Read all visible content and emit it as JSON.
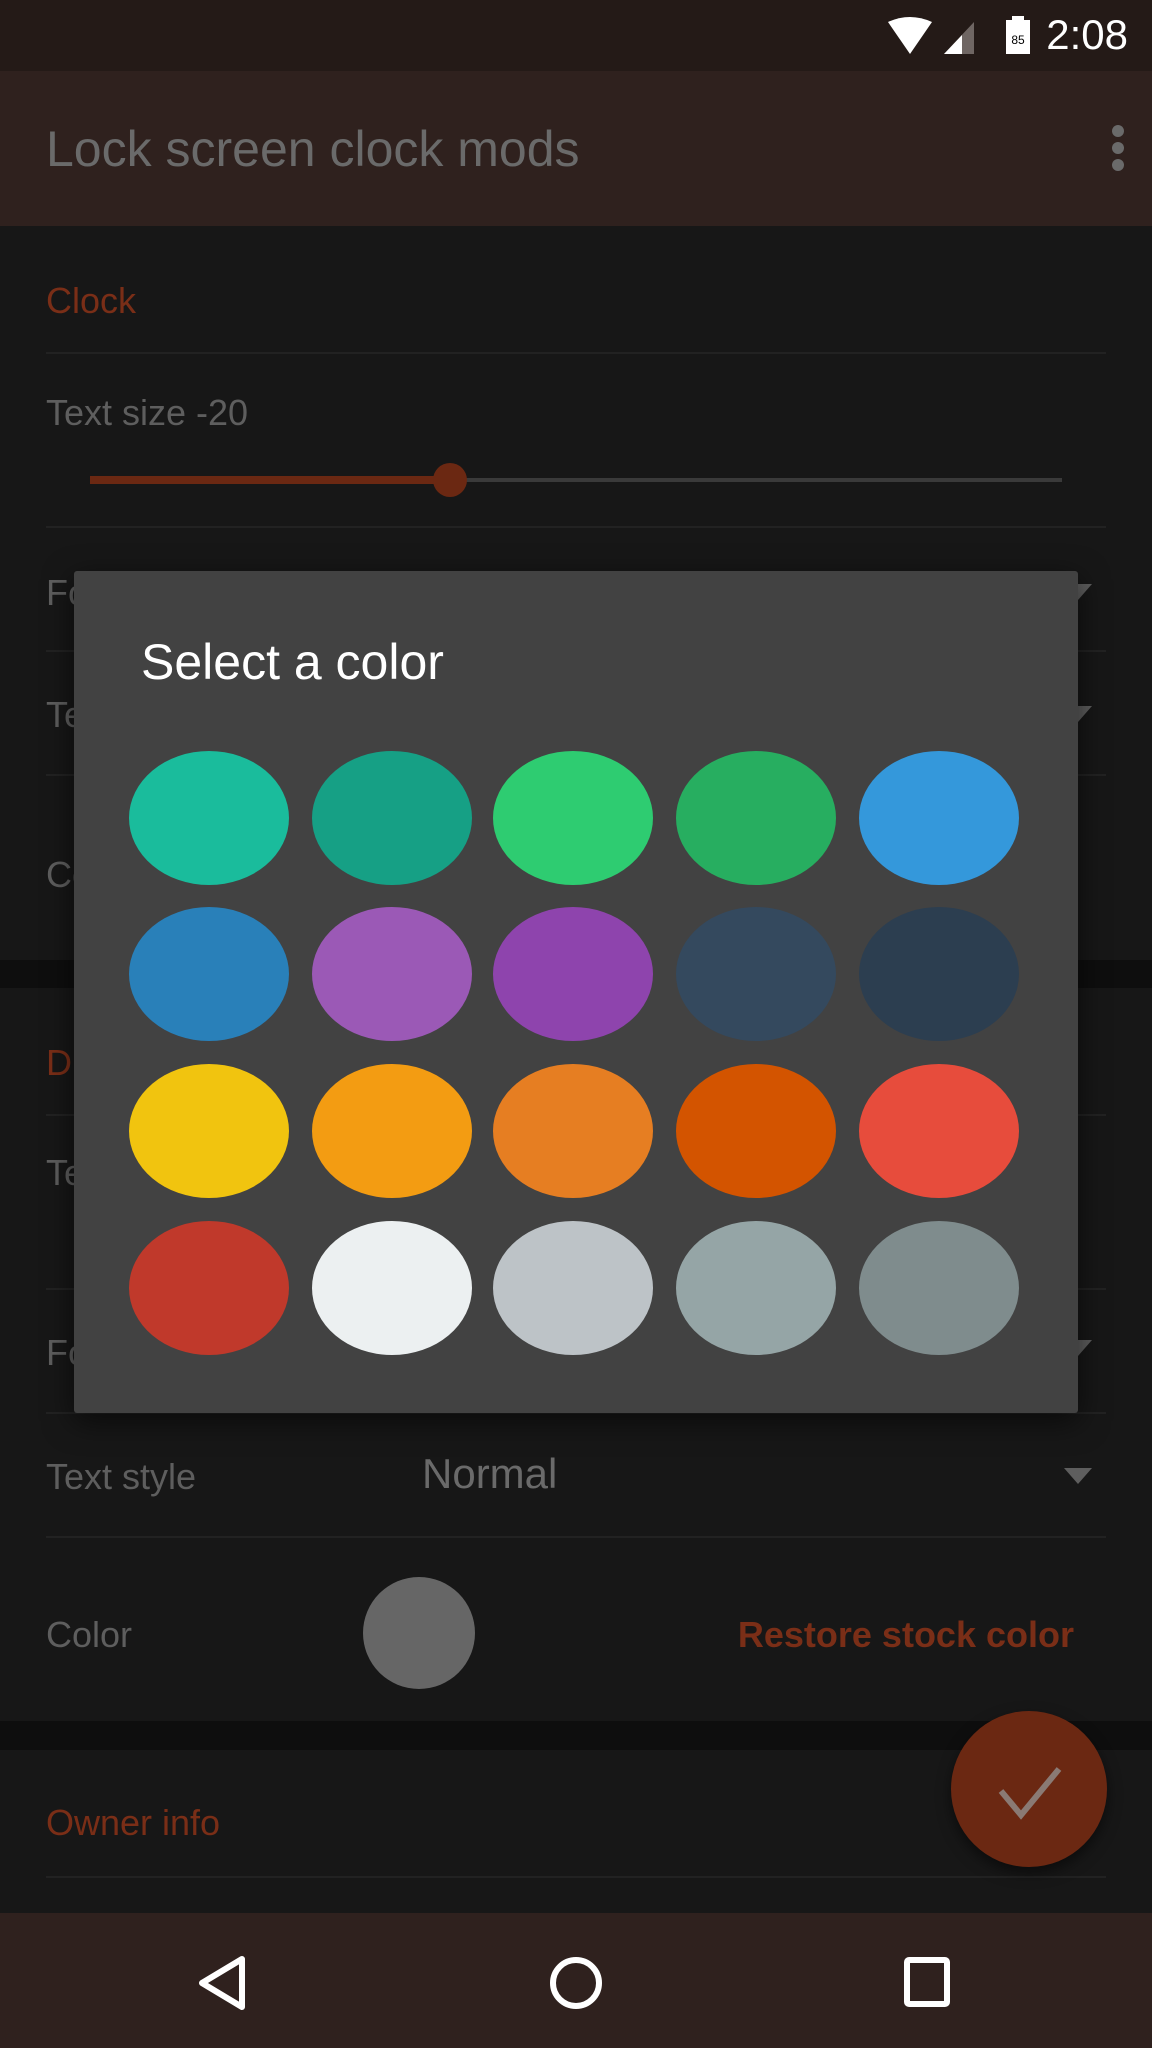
{
  "status_bar": {
    "time": "2:08",
    "battery": "85",
    "icons": [
      "wifi-icon",
      "signal-icon",
      "battery-icon"
    ]
  },
  "app_bar": {
    "title": "Lock screen clock mods",
    "menu_icon": "more-vert-icon"
  },
  "clock_section": {
    "header": "Clock",
    "text_size_label": "Text size -20",
    "text_size_slider_fraction": 0.37,
    "rows_partial": [
      "Fo",
      "Te",
      "Co"
    ]
  },
  "second_section": {
    "header_partial": "D",
    "rows_partial": [
      "Te",
      "Fo"
    ],
    "text_style_label": "Text style",
    "text_style_value": "Normal",
    "color_label": "Color",
    "color_value": "#666666",
    "restore_button": "Restore stock color"
  },
  "owner_section": {
    "header": "Owner info"
  },
  "dialog": {
    "title": "Select a color",
    "colors": [
      "#1abc9c",
      "#16a085",
      "#2ecc71",
      "#27ae60",
      "#3498db",
      "#2980b9",
      "#9b59b6",
      "#8e44ad",
      "#34495e",
      "#2c3e50",
      "#f1c40f",
      "#f39c12",
      "#e67e22",
      "#d35400",
      "#e74c3c",
      "#c0392b",
      "#ecf0f1",
      "#bdc3c7",
      "#95a5a6",
      "#7f8c8d"
    ]
  },
  "fab": {
    "icon": "check-icon"
  },
  "nav_bar": {
    "icons": [
      "back-icon",
      "home-icon",
      "recents-icon"
    ]
  },
  "theme": {
    "accent": "#7a2e17",
    "dialog_bg": "#424242",
    "app_bar": "#2f211e"
  }
}
